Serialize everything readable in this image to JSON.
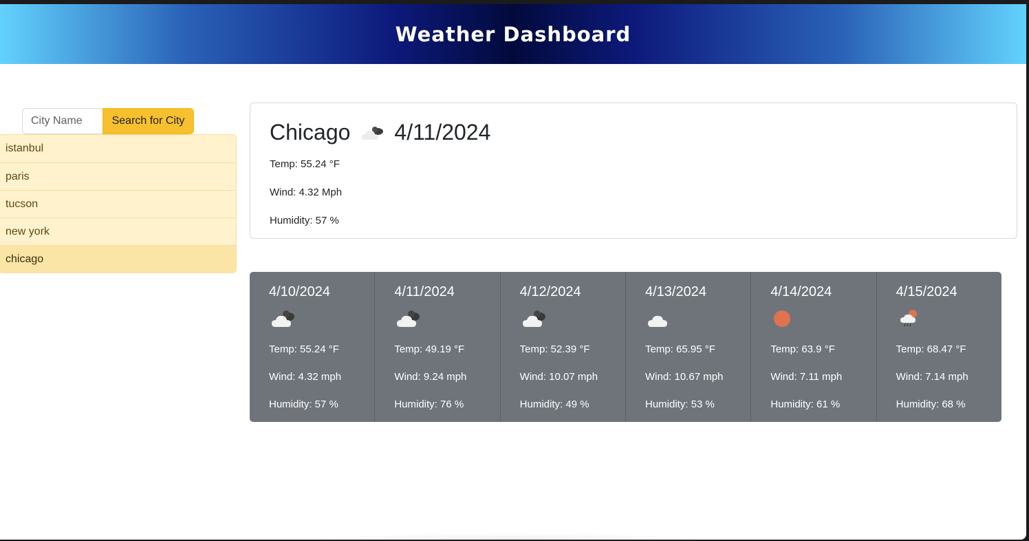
{
  "header": {
    "title": "Weather Dashboard"
  },
  "search": {
    "placeholder": "City Name",
    "button_label": "Search for City"
  },
  "history": [
    {
      "label": "istanbul",
      "active": false
    },
    {
      "label": "paris",
      "active": false
    },
    {
      "label": "tucson",
      "active": false
    },
    {
      "label": "new york",
      "active": false
    },
    {
      "label": "chicago",
      "active": true
    }
  ],
  "current": {
    "city": "Chicago",
    "date": "4/11/2024",
    "icon": "broken-clouds-icon",
    "temp": "Temp: 55.24 °F",
    "wind": "Wind: 4.32 Mph",
    "humidity": "Humidity: 57 %"
  },
  "forecast": [
    {
      "date": "4/10/2024",
      "icon": "broken-clouds-icon",
      "temp": "Temp: 55.24 °F",
      "wind": "Wind: 4.32 mph",
      "humidity": "Humidity: 57 %"
    },
    {
      "date": "4/11/2024",
      "icon": "broken-clouds-icon",
      "temp": "Temp: 49.19 °F",
      "wind": "Wind: 9.24 mph",
      "humidity": "Humidity: 76 %"
    },
    {
      "date": "4/12/2024",
      "icon": "broken-clouds-icon",
      "temp": "Temp: 52.39 °F",
      "wind": "Wind: 10.07 mph",
      "humidity": "Humidity: 49 %"
    },
    {
      "date": "4/13/2024",
      "icon": "cloud-icon",
      "temp": "Temp: 65.95 °F",
      "wind": "Wind: 10.67 mph",
      "humidity": "Humidity: 53 %"
    },
    {
      "date": "4/14/2024",
      "icon": "sun-icon",
      "temp": "Temp: 63.9 °F",
      "wind": "Wind: 7.11 mph",
      "humidity": "Humidity: 61 %"
    },
    {
      "date": "4/15/2024",
      "icon": "rain-sun-icon",
      "temp": "Temp: 68.47 °F",
      "wind": "Wind: 7.14 mph",
      "humidity": "Humidity: 68 %"
    }
  ],
  "colors": {
    "search_button": "#f7c02e",
    "history_bg": "#fff2cd",
    "history_active_bg": "#fbe5a6",
    "forecast_bg": "#6f747b",
    "sun": "#e0734f"
  }
}
